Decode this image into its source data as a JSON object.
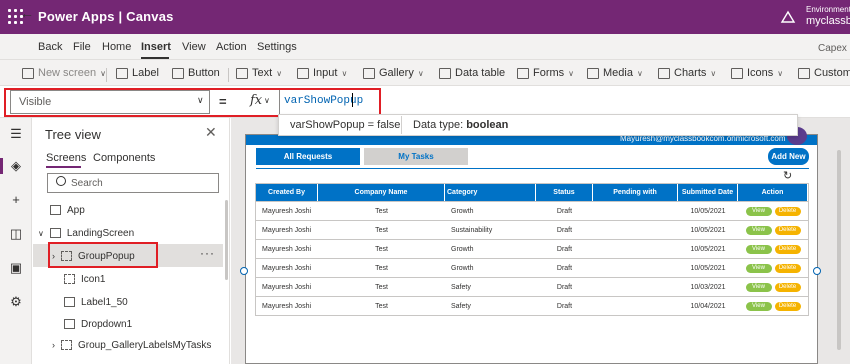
{
  "topbar": {
    "title": "Power Apps  |  Canvas",
    "env_label": "Environment",
    "env_name": "myclassbo"
  },
  "menubar": {
    "back": "Back",
    "items": [
      "File",
      "Home",
      "Insert",
      "View",
      "Action",
      "Settings"
    ],
    "right": "Capex"
  },
  "ribbon": {
    "items": [
      "New screen",
      "Label",
      "Button",
      "Text",
      "Input",
      "Gallery",
      "Data table",
      "Forms",
      "Media",
      "Charts",
      "Icons",
      "Custom"
    ]
  },
  "formula": {
    "property": "Visible",
    "eq": "=",
    "fx": "fx",
    "expression": "varShowPopup"
  },
  "tooltip": {
    "var": "varShowPopup  =  false",
    "type_prefix": "Data type:",
    "type_value": "boolean"
  },
  "tree": {
    "title": "Tree view",
    "tabs": [
      "Screens",
      "Components"
    ],
    "search_placeholder": "Search",
    "items": [
      "App",
      "LandingScreen",
      "GroupPopup",
      "Icon1",
      "Label1_50",
      "Dropdown1",
      "Group_GalleryLabelsMyTasks"
    ],
    "more": "···"
  },
  "app": {
    "header_email": "Mayuresh@myclassbookcom.onmicrosoft.com",
    "tab_all": "All Requests",
    "tab_mine": "My Tasks",
    "add_new": "Add New",
    "columns": [
      "Created By",
      "Company Name",
      "Category",
      "Status",
      "Pending with",
      "Submitted Date",
      "Action"
    ],
    "rows": [
      [
        "Mayuresh Joshi",
        "Test",
        "Growth",
        "Draft",
        "",
        "10/05/2021"
      ],
      [
        "Mayuresh Joshi",
        "Test",
        "Sustainability",
        "Draft",
        "",
        "10/05/2021"
      ],
      [
        "Mayuresh Joshi",
        "Test",
        "Growth",
        "Draft",
        "",
        "10/05/2021"
      ],
      [
        "Mayuresh Joshi",
        "Test",
        "Growth",
        "Draft",
        "",
        "10/05/2021"
      ],
      [
        "Mayuresh Joshi",
        "Test",
        "Safety",
        "Draft",
        "",
        "10/03/2021"
      ],
      [
        "Mayuresh Joshi",
        "Test",
        "Safety",
        "Draft",
        "",
        "10/04/2021"
      ]
    ],
    "view_label": "View",
    "delete_label": "Delete"
  },
  "colors": {
    "brand": "#742774",
    "app_blue": "#0072c6",
    "highlight": "#e01e25",
    "view_green": "#8bc34a",
    "delete_yellow": "#f5b300"
  }
}
